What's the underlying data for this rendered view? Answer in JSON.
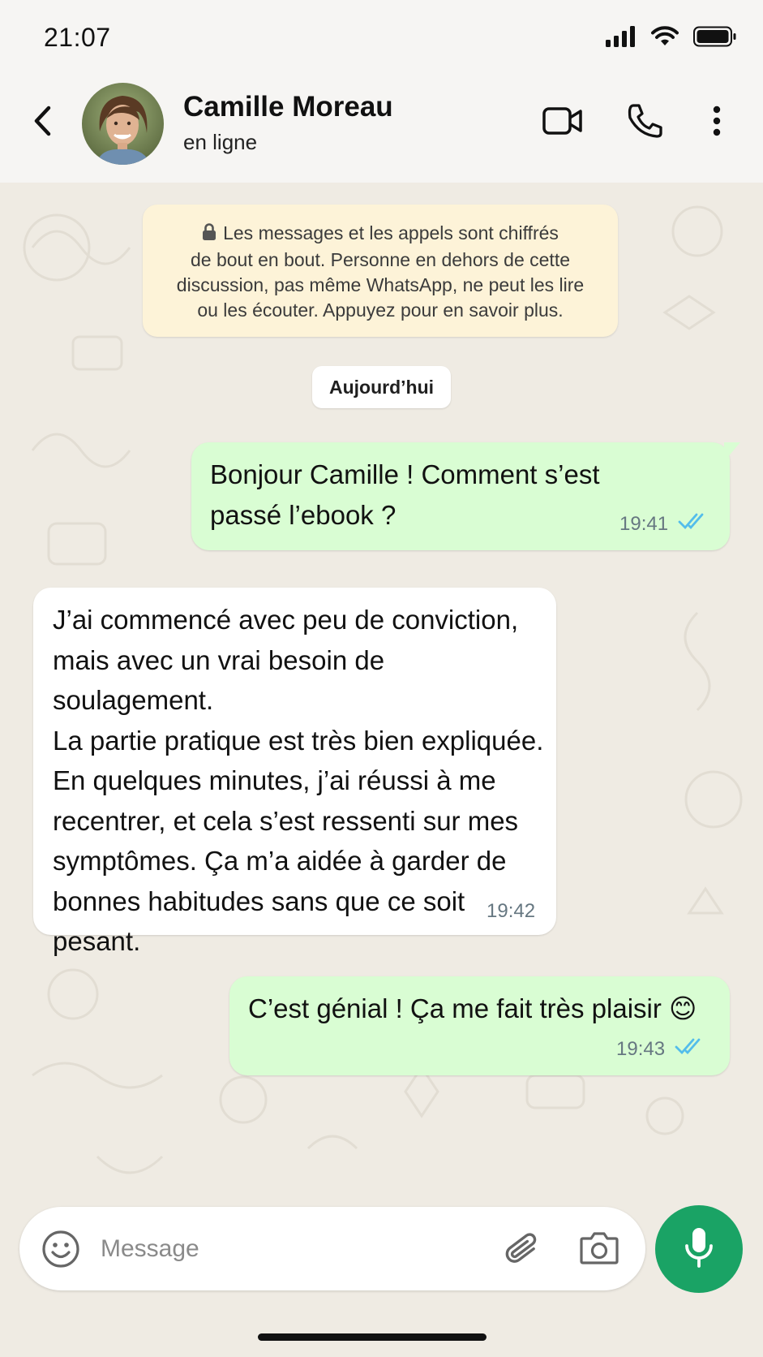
{
  "status_bar": {
    "time": "21:07",
    "icons": [
      "signal-icon",
      "wifi-icon",
      "battery-icon"
    ]
  },
  "header": {
    "back_icon": "chevron-left-icon",
    "contact_name": "Camille Moreau",
    "contact_status": "en ligne",
    "actions": [
      "video-call-icon",
      "voice-call-icon",
      "more-options-icon"
    ]
  },
  "encryption_notice": {
    "icon": "lock-icon",
    "text": "Les messages et les appels sont chiffrés\nde bout en bout. Personne en dehors de cette\ndiscussion, pas même WhatsApp, ne peut les lire\nou les écouter. Appuyez pour en savoir plus."
  },
  "date_separator": "Aujourd’hui",
  "messages": [
    {
      "direction": "outgoing",
      "text": "Bonjour Camille ! Comment s’est\npassé l’ebook ?",
      "time": "19:41",
      "status": "read"
    },
    {
      "direction": "incoming",
      "text": "J’ai commencé avec peu de conviction,\nmais avec un vrai besoin de soulagement.\nLa partie pratique est très bien expliquée.\nEn quelques minutes, j’ai réussi à me\nrecentrer, et cela s’est ressenti sur mes\nsymptômes. Ça m’a aidée à garder de\nbonnes habitudes sans que ce soit\npesant.",
      "time": "19:42"
    },
    {
      "direction": "outgoing",
      "text": "C’est génial ! Ça me fait très plaisir 😊",
      "time": "19:43",
      "status": "read"
    }
  ],
  "composer": {
    "placeholder": "Message",
    "value": "",
    "icons": [
      "emoji-icon",
      "paperclip-icon",
      "camera-icon",
      "microphone-icon"
    ]
  },
  "colors": {
    "outgoing_bubble": "#d9fdd3",
    "incoming_bubble": "#ffffff",
    "notice_background": "#fdf3d8",
    "read_ticks": "#53bdeb",
    "mic_button": "#1aa365",
    "chat_background": "#efebe3"
  }
}
